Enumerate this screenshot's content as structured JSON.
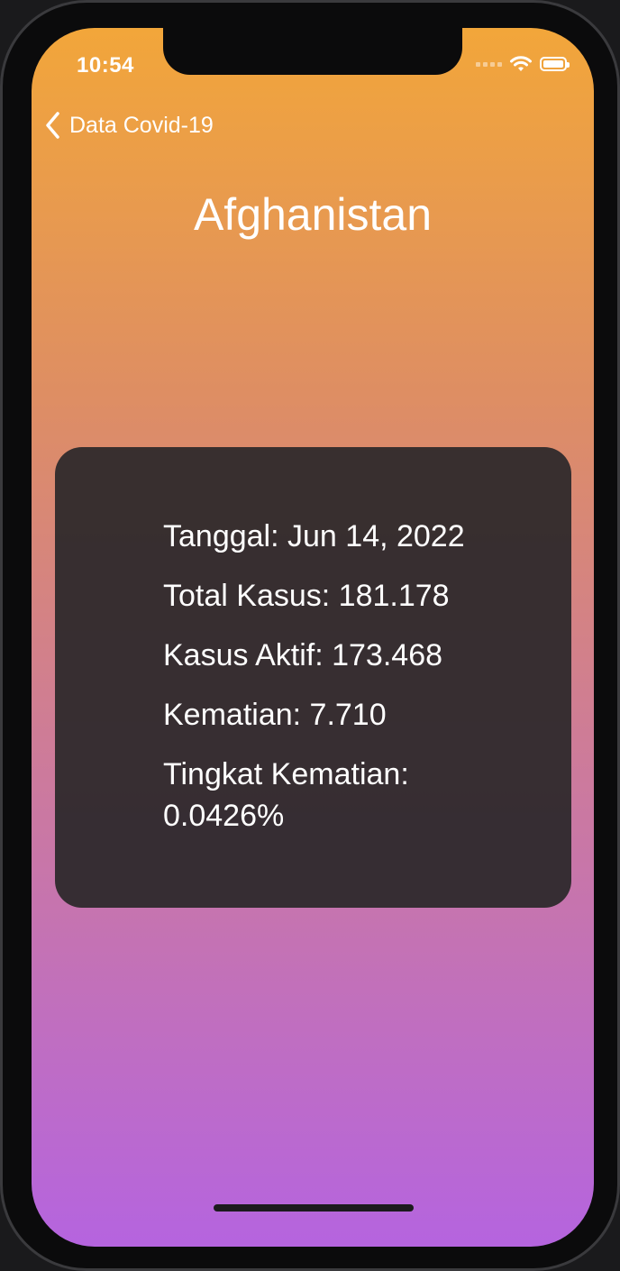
{
  "status_bar": {
    "time": "10:54"
  },
  "nav": {
    "back_label": "Data Covid-19"
  },
  "page": {
    "title": "Afghanistan"
  },
  "stats": {
    "date_label": "Tanggal",
    "date_value": "Jun 14, 2022",
    "total_label": "Total Kasus",
    "total_value": "181.178",
    "active_label": "Kasus Aktif",
    "active_value": "173.468",
    "deaths_label": "Kematian",
    "deaths_value": "7.710",
    "rate_label": "Tingkat Kematian",
    "rate_value": "0.0426%"
  },
  "icons": {
    "back": "chevron-left-icon",
    "wifi": "wifi-icon",
    "battery": "battery-icon",
    "signal": "cellular-signal-icon"
  },
  "colors": {
    "gradient_top": "#f2a63a",
    "gradient_bottom": "#b564df",
    "card": "#2b282a",
    "text": "#ffffff"
  }
}
